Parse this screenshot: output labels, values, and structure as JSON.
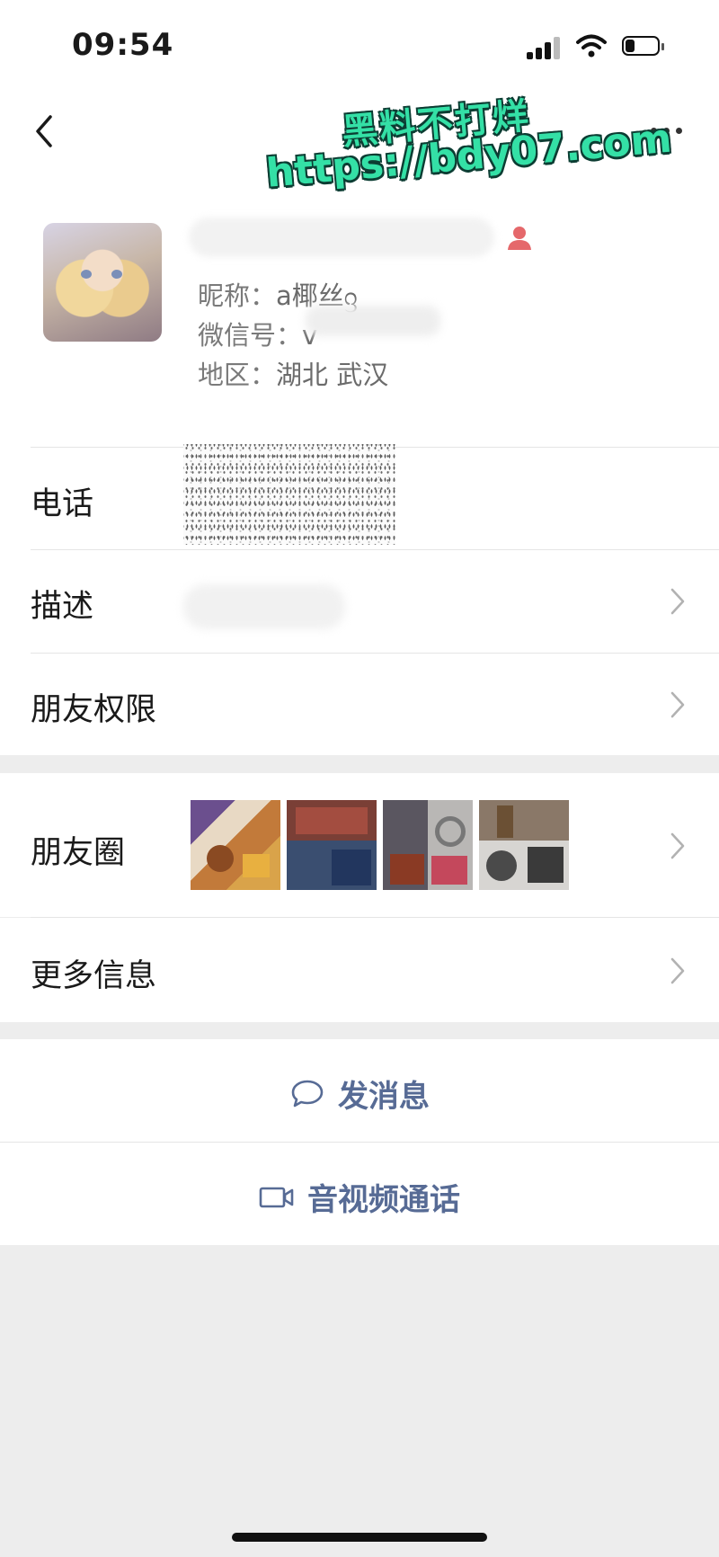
{
  "status": {
    "time": "09:54"
  },
  "watermark": {
    "line1": "黑料不打烊",
    "line2": "https://bdy07.com"
  },
  "profile": {
    "nickname_label": "昵称：",
    "nickname_value": "a椰丝ᦋ",
    "wechat_label": "微信号：",
    "wechat_value": "v",
    "region_label": "地区：",
    "region_value": "湖北 武汉"
  },
  "rows": {
    "phone": "电话",
    "description": "描述",
    "friend_permissions": "朋友权限",
    "moments": "朋友圈",
    "more_info": "更多信息"
  },
  "actions": {
    "message": "发消息",
    "call": "音视频通话"
  },
  "colors": {
    "link": "#576b95",
    "background": "#ededed",
    "badge": "#e5686b",
    "watermark": "#34e0a6"
  },
  "icons": [
    "back-icon",
    "more-icon",
    "person-icon",
    "chevron-right-icon",
    "chat-bubble-icon",
    "video-camera-icon"
  ]
}
